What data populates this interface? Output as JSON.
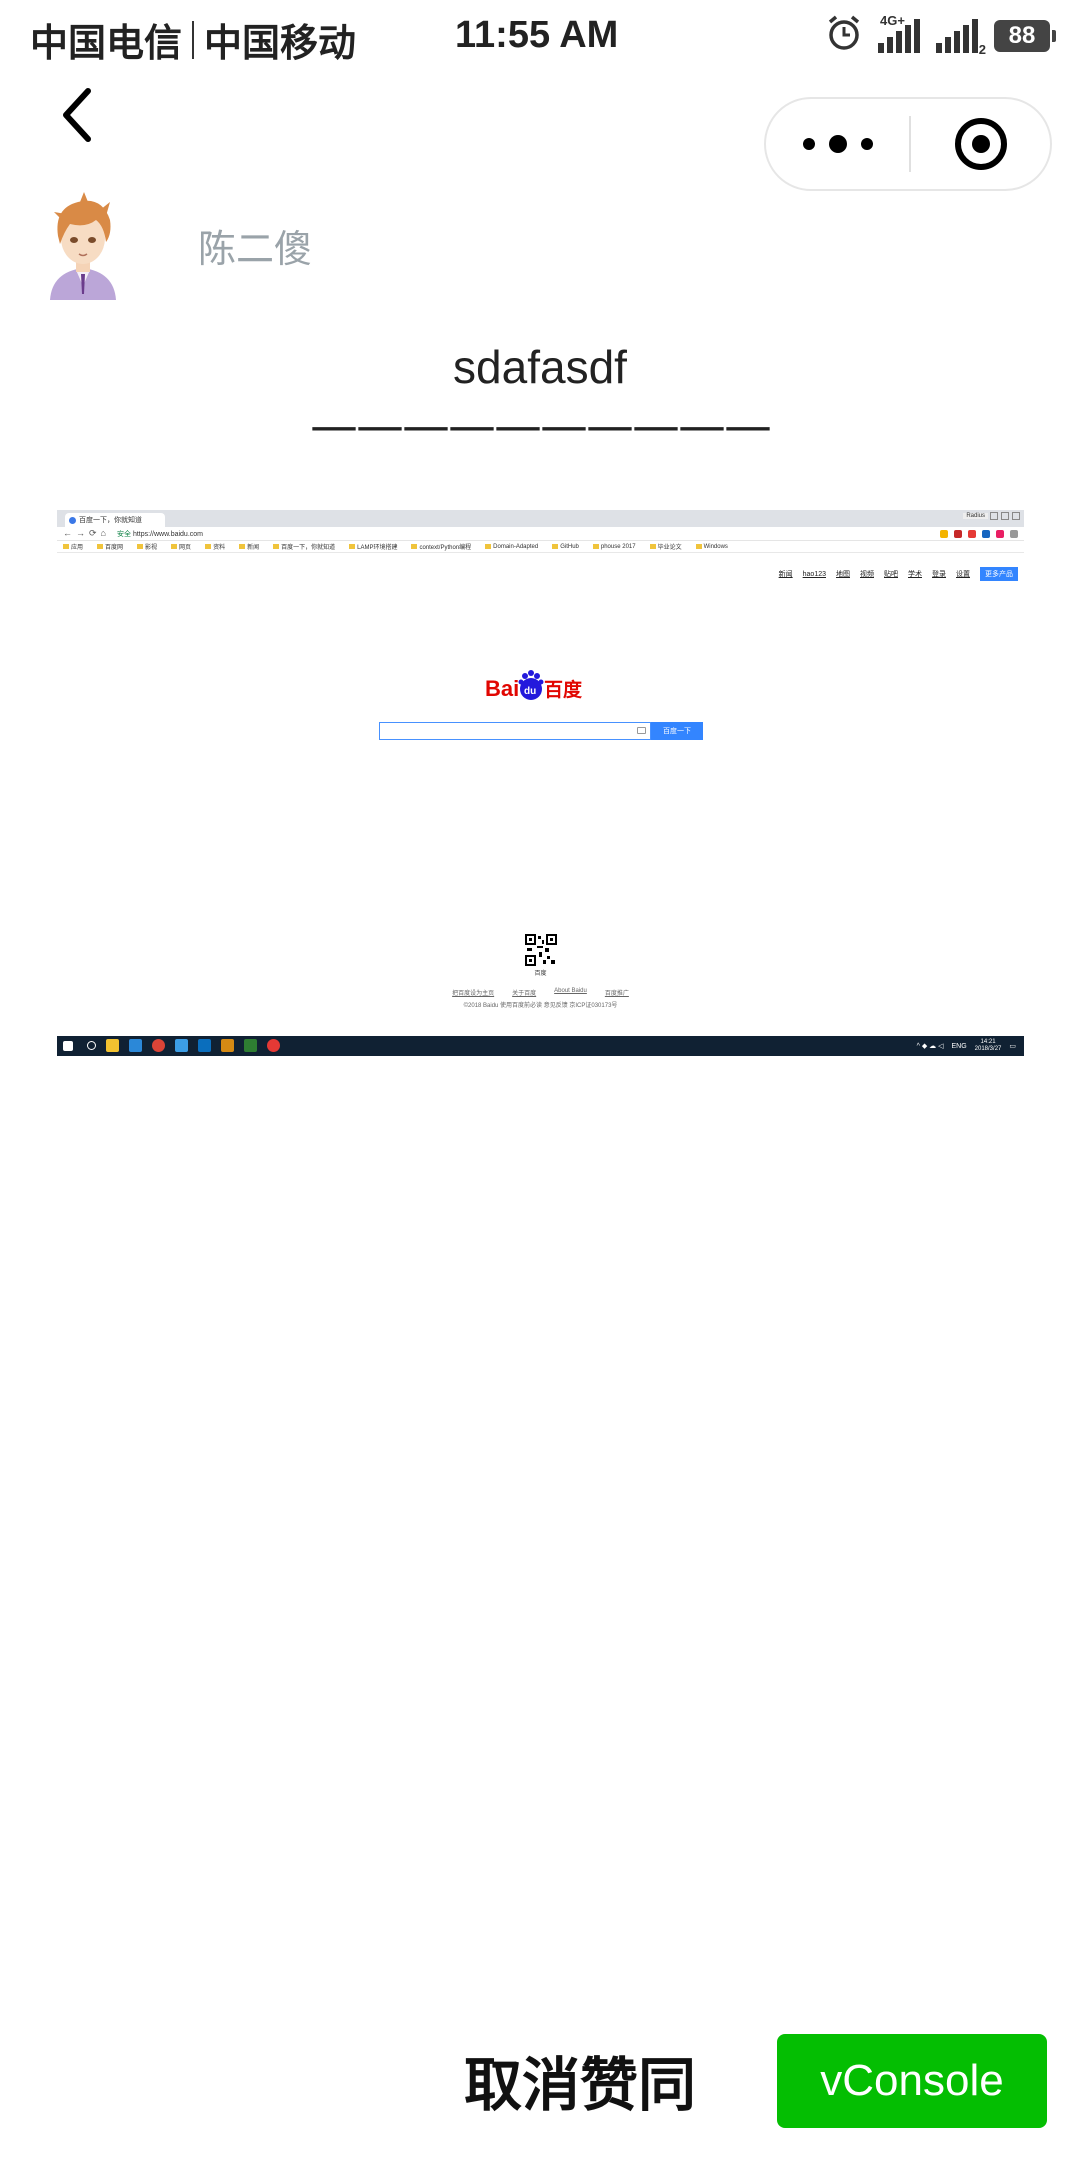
{
  "status_bar": {
    "carrier_1": "中国电信",
    "carrier_2": "中国移动",
    "time": "11:55 AM",
    "network_label": "4G+",
    "sim_label": "2",
    "battery": "88",
    "icons": [
      "alarm-icon",
      "signal-icon",
      "signal-icon",
      "battery-icon"
    ]
  },
  "nav": {
    "back_icon": "chevron-left-icon",
    "capsule_icons": [
      "more-icon",
      "close-miniprogram-icon"
    ]
  },
  "author": {
    "name": "陈二傻"
  },
  "post": {
    "title": "sdafasdf",
    "rule": "——————————"
  },
  "embedded_screenshot": {
    "tab_title": "百度一下，你就知道",
    "user_badge": "Radius",
    "url_secure": "安全",
    "url": "https://www.baidu.com",
    "bookmarks": [
      "应用",
      "百度网",
      "影视",
      "网页",
      "资料",
      "新闻",
      "百度一下，你就知道",
      "LAMP环境搭建",
      "context/Python编程",
      "Domain-Adapted",
      "GitHub",
      "phouse 2017",
      "毕业论文",
      "Windows"
    ],
    "top_nav": [
      "新闻",
      "hao123",
      "地图",
      "视频",
      "贴吧",
      "学术",
      "登录",
      "设置"
    ],
    "more_products": "更多产品",
    "search_button": "百度一下",
    "qr_label": "百度",
    "footer_links": [
      "把百度设为主页",
      "关于百度",
      "About Baidu",
      "百度推广"
    ],
    "copyright": "©2018 Baidu 使用百度前必读 意见反馈 京ICP证030173号",
    "tray_lang": "ENG",
    "tray_time": "14:21",
    "tray_date": "2018/3/27"
  },
  "bottom": {
    "unlike_label": "取消赞同",
    "vconsole_label": "vConsole"
  },
  "colors": {
    "author_name": "#9aa3a9",
    "vconsole_green": "#04be02",
    "baidu_blue": "#3385ff",
    "baidu_red": "#e10601",
    "taskbar": "#102133"
  }
}
